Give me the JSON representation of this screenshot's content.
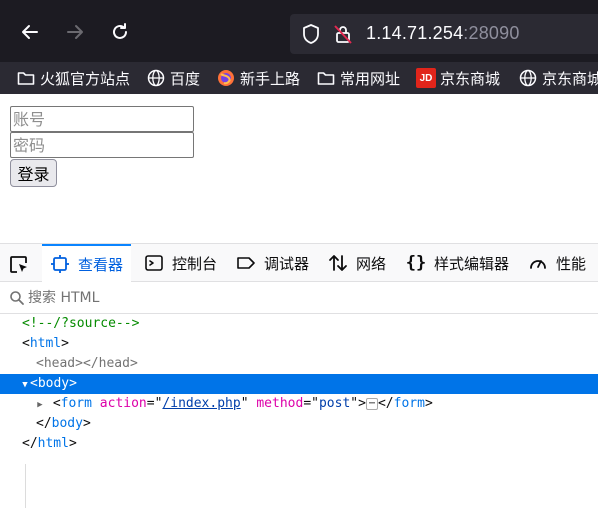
{
  "browser": {
    "nav": {
      "back": "←",
      "forward": "→",
      "reload": "↻"
    },
    "url": {
      "host": "1.14.71.254",
      "port": ":28090"
    },
    "bookmarks": [
      {
        "label": "火狐官方站点",
        "icon": "folder-icon"
      },
      {
        "label": "百度",
        "icon": "globe-icon"
      },
      {
        "label": "新手上路",
        "icon": "firefox-icon"
      },
      {
        "label": "常用网址",
        "icon": "folder-icon"
      },
      {
        "label": "京东商城",
        "icon": "jd-icon",
        "icon_text": "JD"
      },
      {
        "label": "京东商城",
        "icon": "globe-icon"
      }
    ]
  },
  "page": {
    "username_placeholder": "账号",
    "password_placeholder": "密码",
    "submit_label": "登录"
  },
  "devtools": {
    "tabs": [
      {
        "label": "查看器",
        "icon": "inspector-icon",
        "active": true
      },
      {
        "label": "控制台",
        "icon": "console-icon"
      },
      {
        "label": "调试器",
        "icon": "debugger-icon"
      },
      {
        "label": "网络",
        "icon": "network-icon"
      },
      {
        "label": "样式编辑器",
        "icon": "style-editor-icon"
      },
      {
        "label": "性能",
        "icon": "performance-icon"
      }
    ],
    "search_placeholder": "搜索 HTML",
    "tree": {
      "comment": "<!--/?source-->",
      "html_open_tag": "html",
      "head_open": "head",
      "head_close": "head",
      "body_tag": "body",
      "form_tag": "form",
      "form_attr1_name": "action",
      "form_attr1_value": "/index.php",
      "form_attr2_name": "method",
      "form_attr2_value": "post",
      "ellipsis": "⋯",
      "body_close": "body",
      "html_close": "html"
    }
  },
  "colors": {
    "toolbar_bg": "#1c1b22",
    "bookmarks_bg": "#2b2a33",
    "selection": "#0074e8",
    "active_tab": "#0060df"
  }
}
